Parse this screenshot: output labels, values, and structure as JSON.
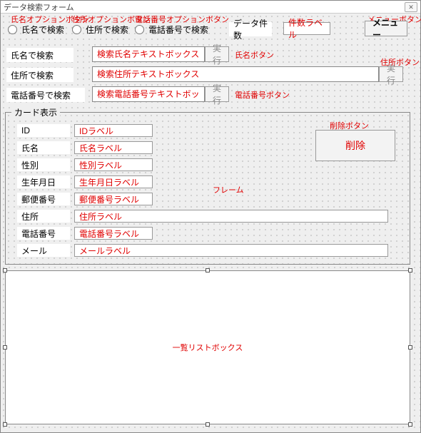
{
  "window": {
    "title": "データ検索フォーム",
    "close_glyph": "✕"
  },
  "annotations": {
    "name_option": "氏名オプションボタン",
    "addr_option": "住所オプションボタン",
    "tel_option": "電話番号オプションボタン",
    "menu_button": "メニューボタン",
    "name_button": "氏名ボタン",
    "addr_button": "住所ボタン",
    "tel_button": "電話番号ボタン",
    "delete_button": "削除ボタン",
    "frame": "フレーム",
    "listbox": "一覧リストボックス"
  },
  "radios": {
    "name": "氏名で検索",
    "addr": "住所で検索",
    "tel": "電話番号で検索"
  },
  "top": {
    "count_label": "データ件数",
    "count_value": "件数ラベル",
    "menu_button": "メニュー"
  },
  "search": {
    "name_label": "氏名で検索",
    "name_placeholder": "検索氏名テキストボックス",
    "addr_label": "住所で検索",
    "addr_placeholder": "検索住所テキストボックス",
    "tel_label": "電話番号で検索",
    "tel_placeholder": "検索電話番号テキストボックス",
    "exec": "実行"
  },
  "frame_title": "カード表示",
  "card": {
    "id_label": "ID",
    "id_value": "IDラベル",
    "name_label": "氏名",
    "name_value": "氏名ラベル",
    "sex_label": "性別",
    "sex_value": "性別ラベル",
    "birth_label": "生年月日",
    "birth_value": "生年月日ラベル",
    "zip_label": "郵便番号",
    "zip_value": "郵便番号ラベル",
    "addr_label": "住所",
    "addr_value": "住所ラベル",
    "tel_label": "電話番号",
    "tel_value": "電話番号ラベル",
    "mail_label": "メール",
    "mail_value": "メールラベル"
  },
  "delete_button": "削除"
}
